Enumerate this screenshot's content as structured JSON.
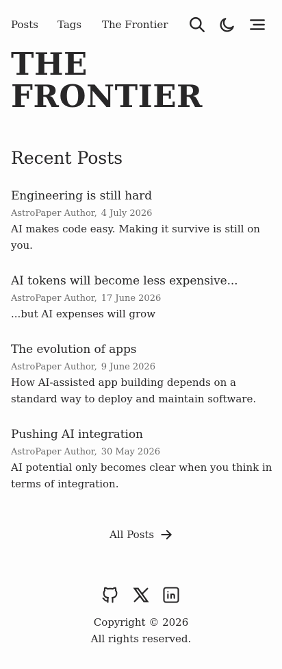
{
  "nav": {
    "links": [
      {
        "label": "Posts"
      },
      {
        "label": "Tags"
      },
      {
        "label": "The Frontier"
      }
    ],
    "icons": [
      "search-icon",
      "moon-icon",
      "menu-icon"
    ]
  },
  "hero": {
    "title": "THE FRONTIER"
  },
  "recent": {
    "heading": "Recent Posts",
    "posts": [
      {
        "title": "Engineering is still hard",
        "author": "AstroPaper Author,",
        "date": "4 July 2026",
        "description": "AI makes code easy. Making it survive is still on you."
      },
      {
        "title": "AI tokens will become less expensive...",
        "author": "AstroPaper Author,",
        "date": "17 June 2026",
        "description": "...but AI expenses will grow"
      },
      {
        "title": "The evolution of apps",
        "author": "AstroPaper Author,",
        "date": "9 June 2026",
        "description": "How AI-assisted app building depends on a standard way to deploy and maintain software."
      },
      {
        "title": "Pushing AI integration",
        "author": "AstroPaper Author,",
        "date": "30 May 2026",
        "description": "AI potential only becomes clear when you think in terms of integration."
      }
    ]
  },
  "all_posts": {
    "label": "All Posts",
    "icon": "arrow-right-icon"
  },
  "social": {
    "icons": [
      "github-icon",
      "x-icon",
      "linkedin-icon"
    ]
  },
  "footer": {
    "copyright": "Copyright © 2026",
    "rights": "All rights reserved."
  }
}
